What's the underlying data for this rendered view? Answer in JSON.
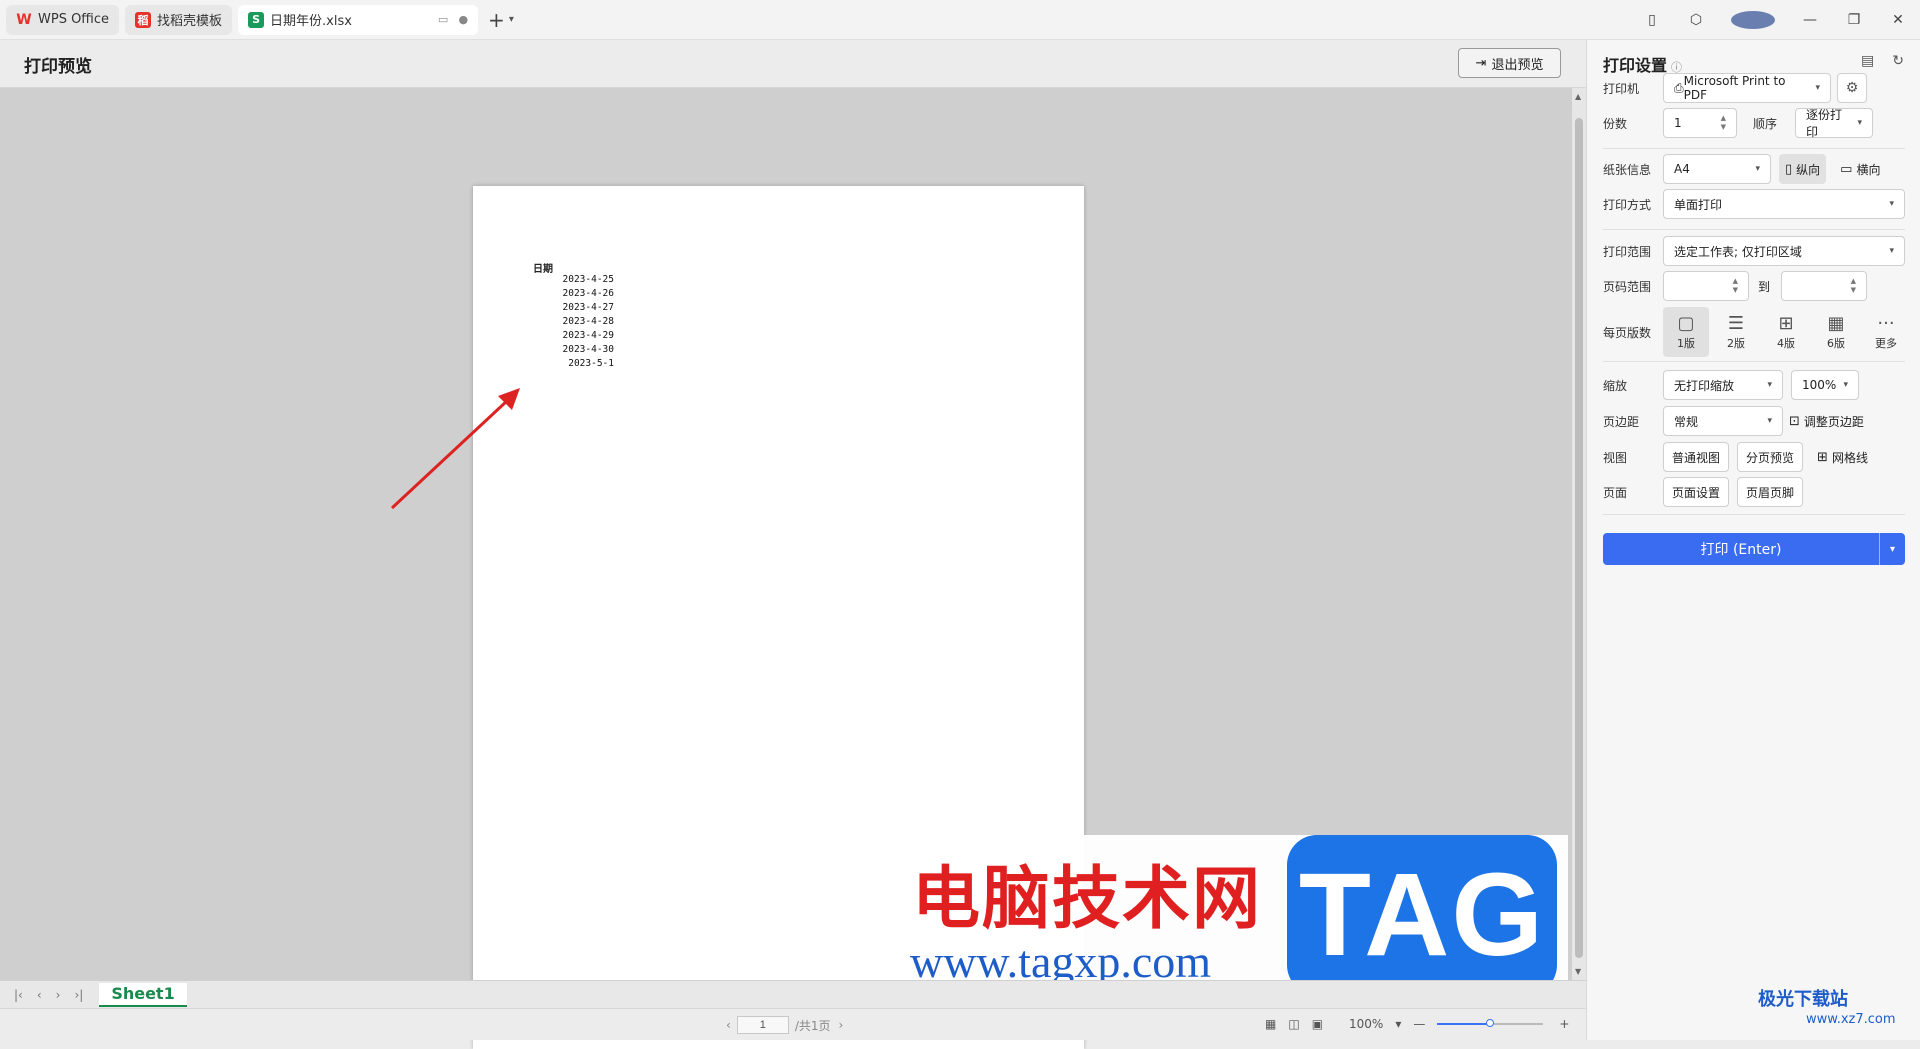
{
  "titlebar": {
    "tabs": [
      {
        "label": "WPS Office",
        "icon": "wps-logo-icon"
      },
      {
        "label": "找稻壳模板",
        "icon": "daoke-icon"
      },
      {
        "label": "日期年份.xlsx",
        "icon": "sheet-icon"
      }
    ],
    "sheet_icon_letter": "S"
  },
  "preview": {
    "title": "打印预览",
    "exit_label": "退出预览"
  },
  "sheet": {
    "header": "日期",
    "dates": [
      "2023-4-25",
      "2023-4-26",
      "2023-4-27",
      "2023-4-28",
      "2023-4-29",
      "2023-4-30",
      "2023-5-1"
    ]
  },
  "watermark": {
    "cn": "电脑技术网",
    "url": "www.tagxp.com",
    "tag": "TAG",
    "corner_brand": "极光下载站",
    "corner_url": "www.xz7.com"
  },
  "sheetbar": {
    "tab": "Sheet1"
  },
  "status": {
    "page_value": "1",
    "page_total": "/共1页",
    "zoom": "100%",
    "zoom_level": 0.5
  },
  "panel": {
    "title": "打印设置",
    "printer_label": "打印机",
    "printer_value": "Microsoft Print to PDF",
    "copies_label": "份数",
    "copies_value": "1",
    "order_label": "顺序",
    "order_value": "逐份打印",
    "paper_label": "纸张信息",
    "paper_value": "A4",
    "portrait": "纵向",
    "landscape": "横向",
    "mode_label": "打印方式",
    "mode_value": "单面打印",
    "range_label": "打印范围",
    "range_value": "选定工作表; 仅打印区域",
    "pages_label": "页码范围",
    "pages_to": "到",
    "per_page_label": "每页版数",
    "layouts": [
      "1版",
      "2版",
      "4版",
      "6版",
      "更多"
    ],
    "scale_label": "缩放",
    "scale_value": "无打印缩放",
    "scale_pct": "100%",
    "margin_label": "页边距",
    "margin_value": "常规",
    "adjust_margin": "调整页边距",
    "view_label": "视图",
    "normal_view": "普通视图",
    "page_break_view": "分页预览",
    "gridlines": "网格线",
    "page_label": "页面",
    "page_setup": "页面设置",
    "header_footer": "页眉页脚",
    "print_button": "打印 (Enter)"
  },
  "colors": {
    "accent": "#3a6cf2",
    "sheet_green": "#1a8a4c",
    "watermark_red": "#e02020",
    "watermark_blue": "#1c74e6"
  }
}
